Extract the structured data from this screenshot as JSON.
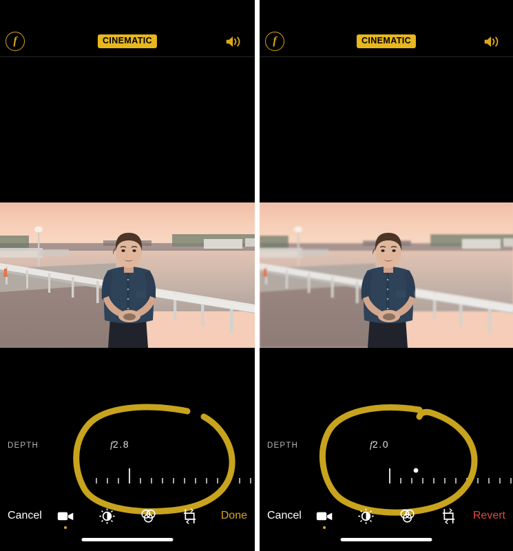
{
  "meta": {
    "app": "Photos - Cinematic Video Editor",
    "layout": "two side-by-side iPhone screenshots comparing depth f-stop settings"
  },
  "colors": {
    "accent_yellow": "#d9a818",
    "badge_yellow": "#e8b71d",
    "revert_red": "#e8443a",
    "background": "#000000",
    "tick_white": "#d8d8d8",
    "annotation_yellow": "#c8a31e"
  },
  "panels": [
    {
      "id": "left",
      "topbar": {
        "aperture_button": "f",
        "aperture_icon": "aperture-f-icon",
        "mode_badge": "CINEMATIC",
        "speaker_icon": "speaker-on-icon"
      },
      "photo": {
        "alt": "Man in dark blue shirt standing on waterfront pier at sunset with railing and calm water",
        "sky_top": "#f2c3ab",
        "sky_mid": "#f6cdb5",
        "water": "#c9b5ad",
        "shirt": "#2c3f57"
      },
      "depth": {
        "label": "DEPTH",
        "value": "2.8",
        "value_prefix": "f",
        "value_display": "f2.8",
        "marker_position_pct": 50.8,
        "dot_visible": false,
        "tick_count": 23
      },
      "annotation": {
        "type": "hand-drawn-circle",
        "color": "#c8a31e",
        "state": "open-gap-top-right"
      },
      "toolbar": {
        "cancel_label": "Cancel",
        "action_label": "Done",
        "action_style": "done",
        "icons": [
          {
            "name": "video-camera-icon",
            "active": true
          },
          {
            "name": "adjust-dial-icon",
            "active": false
          },
          {
            "name": "color-filters-icon",
            "active": false
          },
          {
            "name": "crop-rotate-icon",
            "active": false
          }
        ]
      },
      "home_indicator": true
    },
    {
      "id": "right",
      "topbar": {
        "aperture_button": "f",
        "aperture_icon": "aperture-f-icon",
        "mode_badge": "CINEMATIC",
        "speaker_icon": "speaker-on-icon"
      },
      "photo": {
        "alt": "Same waterfront pier sunset scene with stronger background blur at f2.0",
        "sky_top": "#f2c3ab",
        "sky_mid": "#f6cdb5",
        "water": "#c9b5ad",
        "shirt": "#2c3f57"
      },
      "depth": {
        "label": "DEPTH",
        "value": "2.0",
        "value_prefix": "f",
        "value_display": "f2.0",
        "marker_position_pct": 51.5,
        "dot_visible": true,
        "dot_position_pct": 61.5,
        "tick_count": 23
      },
      "annotation": {
        "type": "hand-drawn-circle",
        "color": "#c8a31e",
        "state": "closed-overlap-top-right"
      },
      "toolbar": {
        "cancel_label": "Cancel",
        "action_label": "Revert",
        "action_style": "revert",
        "icons": [
          {
            "name": "video-camera-icon",
            "active": true
          },
          {
            "name": "adjust-dial-icon",
            "active": false
          },
          {
            "name": "color-filters-icon",
            "active": false
          },
          {
            "name": "crop-rotate-icon",
            "active": false
          }
        ]
      },
      "home_indicator": true
    }
  ]
}
